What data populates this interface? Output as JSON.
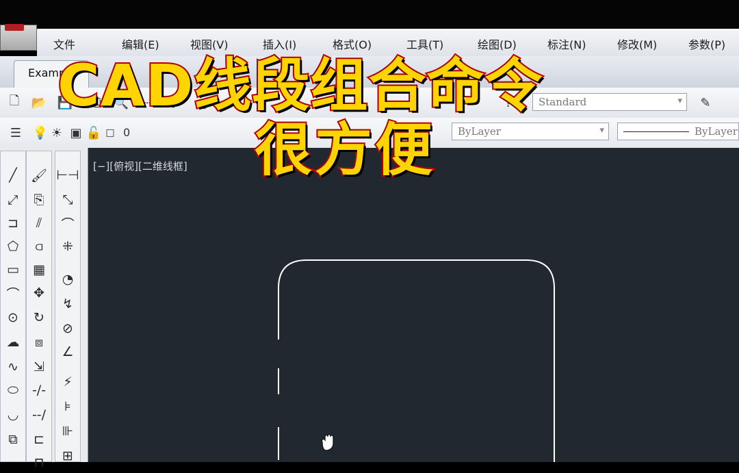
{
  "menu": {
    "items": [
      "文件",
      "编辑(E)",
      "视图(V)",
      "插入(I)",
      "格式(O)",
      "工具(T)",
      "绘图(D)",
      "标注(N)",
      "修改(M)",
      "参数(P)"
    ]
  },
  "tab": {
    "label": "Example"
  },
  "toolbar": {
    "style_combo": "Standard",
    "layer_value": "0",
    "color_combo": "ByLayer",
    "linetype_combo": "ByLayer"
  },
  "viewport": {
    "label": "[−][俯视][二维线框]"
  },
  "overlay": {
    "line1": "CAD线段组合命令",
    "line2": "很方便"
  },
  "icons": {
    "draw": [
      "line-icon",
      "xline-icon",
      "polyline-icon",
      "polygon-icon",
      "rectangle-icon",
      "arc-icon",
      "circle-icon",
      "revcloud-icon",
      "spline-icon",
      "ellipse-icon",
      "ellipse-arc-icon",
      "insert-block-icon"
    ],
    "modify": [
      "erase-icon",
      "copy-icon",
      "mirror-icon",
      "offset-icon",
      "array-icon",
      "move-icon",
      "rotate-icon",
      "scale-icon",
      "stretch-icon",
      "trim-icon",
      "extend-icon",
      "break-icon",
      "join-icon"
    ],
    "dimension": [
      "linear-dim-icon",
      "aligned-dim-icon",
      "arc-length-icon",
      "ordinate-icon",
      "radius-icon",
      "jogged-icon",
      "diameter-icon",
      "angular-icon",
      "quick-dim-icon",
      "baseline-icon",
      "continue-icon",
      "tolerance-icon"
    ]
  },
  "colors": {
    "canvas_bg": "#212830",
    "drawing_line": "#ffffff",
    "overlay_fill": "#ffd400",
    "overlay_stroke": "#d80000"
  }
}
